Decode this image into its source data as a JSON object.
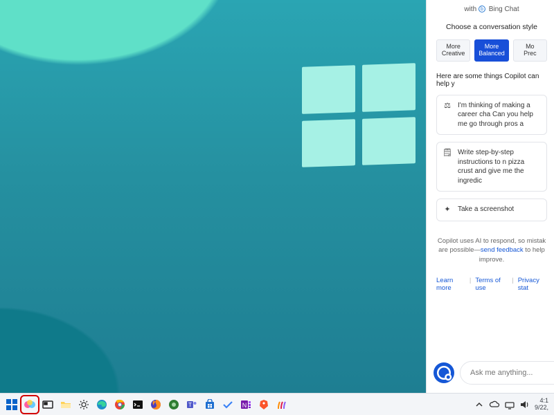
{
  "copilot": {
    "with_prefix": "with",
    "with_brand": "Bing Chat",
    "style_label": "Choose a conversation style",
    "styles": [
      {
        "line1": "More",
        "line2": "Creative",
        "selected": false
      },
      {
        "line1": "More",
        "line2": "Balanced",
        "selected": true
      },
      {
        "line1": "Mo",
        "line2": "Prec",
        "selected": false
      }
    ],
    "intro": "Here are some things Copilot can help y",
    "suggestions": [
      {
        "icon": "⚖",
        "text": "I'm thinking of making a career cha Can you help me go through pros a"
      },
      {
        "icon": "🗒",
        "text": "Write step-by-step instructions to n pizza crust and give me the ingredic"
      },
      {
        "icon": "✦",
        "text": "Take a screenshot"
      }
    ],
    "footnote_pre": "Copilot uses AI to respond, so mistak are possible—",
    "footnote_link": "send feedback",
    "footnote_post": " to help improve.",
    "links": [
      "Learn more",
      "Terms of use",
      "Privacy stat"
    ],
    "ask_placeholder": "Ask me anything..."
  },
  "taskbar": {
    "icons": [
      {
        "name": "start-icon"
      },
      {
        "name": "copilot-taskbar-icon",
        "highlight": true
      },
      {
        "name": "task-view-icon"
      },
      {
        "name": "file-explorer-icon"
      },
      {
        "name": "settings-icon"
      },
      {
        "name": "edge-icon"
      },
      {
        "name": "chrome-icon"
      },
      {
        "name": "terminal-icon"
      },
      {
        "name": "firefox-icon"
      },
      {
        "name": "app-green-icon"
      },
      {
        "name": "teams-icon"
      },
      {
        "name": "store-icon"
      },
      {
        "name": "todo-icon"
      },
      {
        "name": "onenote-icon"
      },
      {
        "name": "brave-icon"
      },
      {
        "name": "app-stripes-icon"
      }
    ]
  },
  "systray": {
    "time": "4:1",
    "date": "9/22,"
  }
}
